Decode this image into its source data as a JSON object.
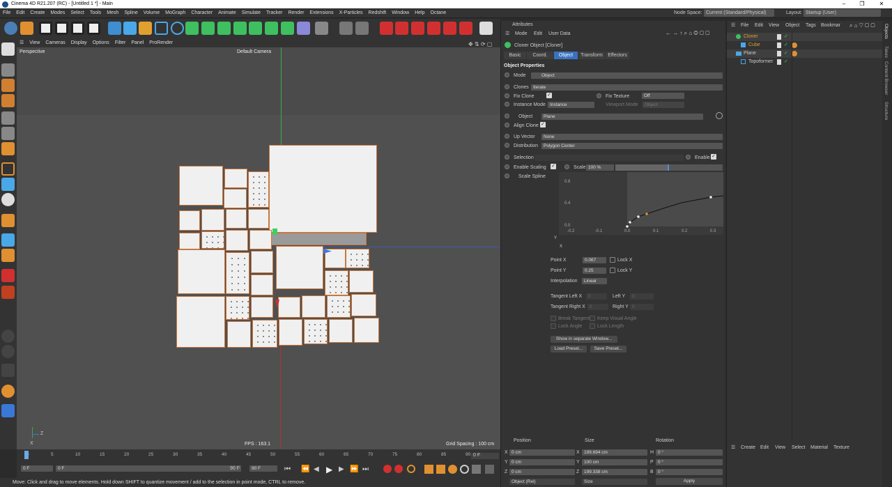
{
  "window": {
    "title": "Cinema 4D R21.207 (RC) - [Untitled 1 *] - Main",
    "minimize": "–",
    "maximize": "❐",
    "close": "✕"
  },
  "menu": [
    "File",
    "Edit",
    "Create",
    "Modes",
    "Select",
    "Tools",
    "Mesh",
    "Spline",
    "Volume",
    "MoGraph",
    "Character",
    "Animate",
    "Simulate",
    "Tracker",
    "Render",
    "Extensions",
    "X-Particles",
    "Redshift",
    "Window",
    "Help",
    "Octane"
  ],
  "node_space": {
    "label": "Node Space:",
    "value": "Current (Standard/Physical)"
  },
  "layout": {
    "label": "Layout:",
    "value": "Startup (User)"
  },
  "viewport": {
    "menu": [
      "View",
      "Cameras",
      "Display",
      "Options",
      "Filter",
      "Panel",
      "ProRender"
    ],
    "name": "Perspective",
    "camera": "Default Camera",
    "fps": "FPS : 163.1",
    "grid_spacing": "Grid Spacing : 100 cm",
    "axis_z": "Z",
    "axis_x": "X"
  },
  "timeline": {
    "ticks": [
      "0",
      "5",
      "10",
      "15",
      "20",
      "25",
      "30",
      "35",
      "40",
      "45",
      "50",
      "55",
      "60",
      "65",
      "70",
      "75",
      "80",
      "85",
      "90"
    ],
    "current_frame": "0 F"
  },
  "playback": {
    "start": "0 F",
    "current": "0 F",
    "end": "90 F",
    "end2": "90 F"
  },
  "status": "Move: Click and drag to move elements. Hold down SHIFT to quantize movement / add to the selection in point mode, CTRL to remove.",
  "attributes": {
    "title": "Attributes",
    "menu": [
      "Mode",
      "Edit",
      "User Data"
    ],
    "object_name": "Cloner Object [Cloner]",
    "tabs": [
      "Basic",
      "Coord.",
      "Object",
      "Transform",
      "Effectors"
    ],
    "active_tab": "Object",
    "section": "Object Properties",
    "mode_label": "Mode",
    "mode_value": "Object",
    "clones_label": "Clones",
    "clones_value": "Iterate",
    "fix_clone_label": "Fix Clone",
    "fix_texture_label": "Fix Texture",
    "fix_texture_value": "Off",
    "instance_mode_label": "Instance Mode",
    "instance_mode_value": "Instance",
    "viewport_mode_label": "Viewport Mode",
    "viewport_mode_value": "Object",
    "object_label": "Object",
    "object_value": "Plane",
    "align_clone_label": "Align Clone",
    "up_vector_label": "Up Vector",
    "up_vector_value": "None",
    "distribution_label": "Distribution",
    "distribution_value": "Polygon Center",
    "selection_label": "Selection",
    "enable_label": "Enable",
    "enable_scaling_label": "Enable Scaling",
    "scale_label": "Scale",
    "scale_value": "100 %",
    "scale_fraction": 0.5,
    "scale_spline_label": "Scale Spline",
    "spline_y_ticks": [
      "0.8",
      "0.4",
      "0.0"
    ],
    "spline_x_ticks": [
      "-0.2",
      "-0.1",
      "0.0",
      "0.1",
      "0.2",
      "0.3"
    ],
    "spline_y_axis": "Y",
    "spline_x_axis": "X",
    "point_x_label": "Point X",
    "point_x_value": "0.067",
    "lock_x_label": "Lock X",
    "point_y_label": "Point Y",
    "point_y_value": "0.25",
    "lock_y_label": "Lock Y",
    "interpolation_label": "Interpolation",
    "interpolation_value": "Linear",
    "tangent_left_x_label": "Tangent Left X",
    "tangent_left_x_value": "0",
    "left_y_label": "Left Y",
    "left_y_value": "0",
    "tangent_right_x_label": "Tangent Right X",
    "tangent_right_x_value": "0",
    "right_y_label": "Right Y",
    "right_y_value": "0",
    "break_tangent_label": "Break Tangent",
    "keep_visual_angle_label": "Keep Visual Angle",
    "lock_angle_label": "Lock Angle",
    "lock_length_label": "Lock Length",
    "show_window_button": "Show in separate Window...",
    "load_preset_button": "Load Preset...",
    "save_preset_button": "Save Preset..."
  },
  "object_manager": {
    "menu": [
      "File",
      "Edit",
      "View",
      "Object",
      "Tags",
      "Bookmar"
    ],
    "objects": [
      {
        "name": "Cloner",
        "color": "#e0a030"
      },
      {
        "name": "Cube",
        "color": "#e0a030"
      },
      {
        "name": "Plane",
        "color": "#cccccc"
      },
      {
        "name": "Topoformer",
        "color": "#cccccc"
      }
    ]
  },
  "side_tabs": [
    "Objects",
    "Takes",
    "Content Browser",
    "Structure"
  ],
  "coordinates": {
    "headers": [
      "Position",
      "Size",
      "Rotation"
    ],
    "rows": [
      {
        "axis": "X",
        "pos": "0 cm",
        "saxis": "X",
        "size": "199.694 cm",
        "raxis": "H",
        "rot": "0 °"
      },
      {
        "axis": "Y",
        "pos": "0 cm",
        "saxis": "Y",
        "size": "100 cm",
        "raxis": "P",
        "rot": "0 °"
      },
      {
        "axis": "Z",
        "pos": "0 cm",
        "saxis": "Z",
        "size": "199.338 cm",
        "raxis": "B",
        "rot": "0 °"
      }
    ],
    "mode1": "Object (Rel)",
    "mode2": "Size",
    "apply": "Apply"
  },
  "material_manager": {
    "menu": [
      "Create",
      "Edit",
      "View",
      "Select",
      "Material",
      "Texture"
    ]
  }
}
